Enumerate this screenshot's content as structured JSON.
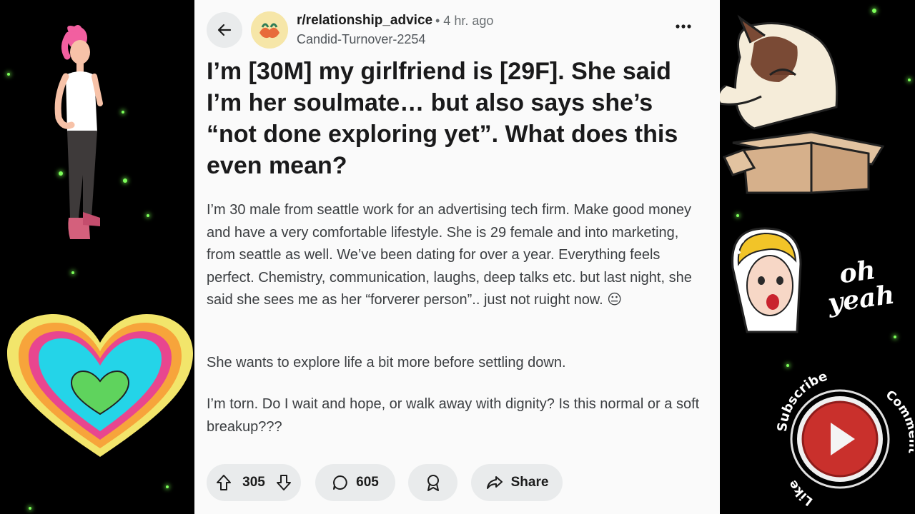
{
  "post": {
    "subreddit": "r/relationship_advice",
    "time": "• 4 hr. ago",
    "author": "Candid-Turnover-2254",
    "title": "I’m [30M] my girlfriend is [29F]. She said I’m her soulmate… but also says she’s “not done exploring yet”. What does this even mean?",
    "body": [
      "I’m 30 male from seattle work for an advertising tech firm. Make good money and have a very comfortable lifestyle. She is 29 female and into marketing, from seattle as well. We’ve been dating for over a year. Everything feels perfect. Chemistry, communication, laughs, deep talks etc. but last night, she said she sees me as her “forverer person”.. just not ruight now. 😐",
      "She wants to explore life a bit more before settling down.",
      "I’m torn. Do I wait and hope, or walk away with dignity? Is this normal or a soft breakup???"
    ]
  },
  "actions": {
    "votes": "305",
    "comments": "605",
    "share": "Share"
  },
  "stickers": {
    "oh_yeah": "oh yeah",
    "subscribe": "Subscribe",
    "comment": "Comment",
    "like": "Like"
  },
  "colors": {
    "card_bg": "#fafafa",
    "pill_bg": "#e9ebec",
    "sparkle": "#7dff5a",
    "play_red": "#c9302c"
  }
}
